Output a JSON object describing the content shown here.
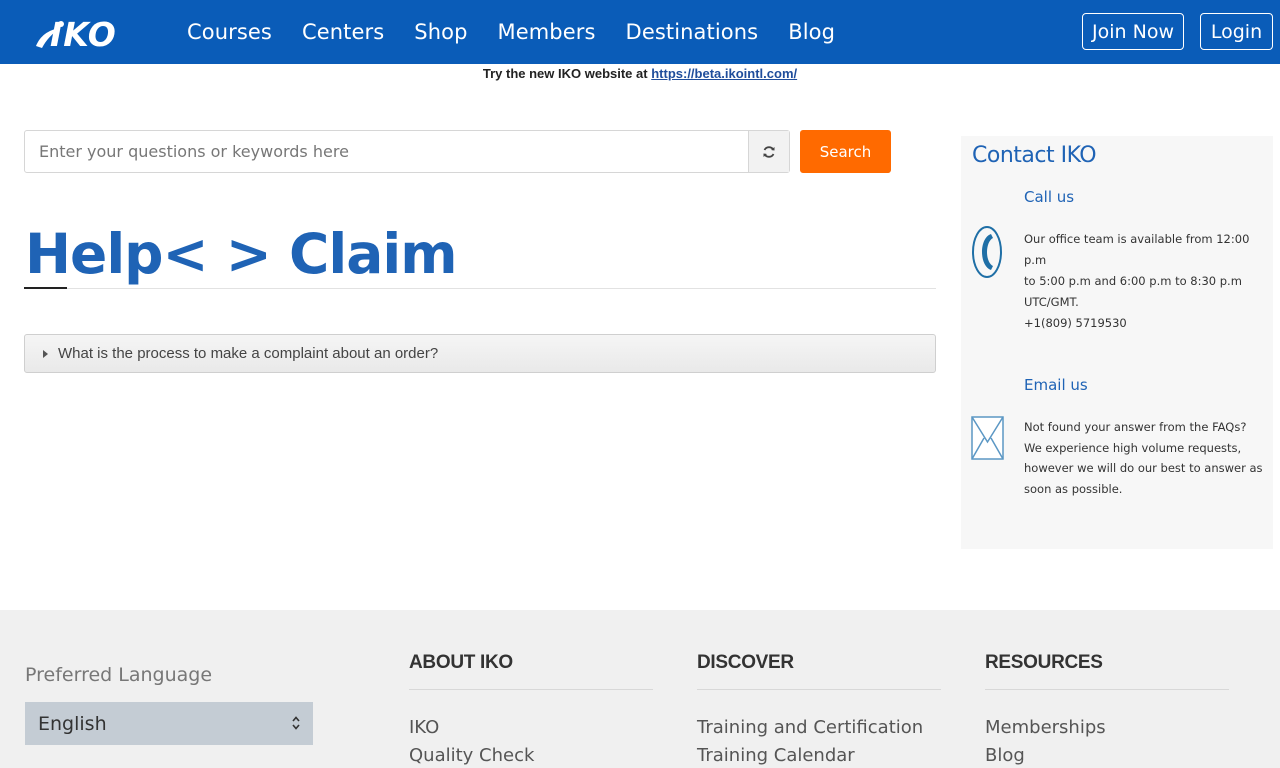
{
  "header": {
    "logo_text": "IKO",
    "nav": [
      "Courses",
      "Centers",
      "Shop",
      "Members",
      "Destinations",
      "Blog"
    ],
    "join_label": "Join Now",
    "login_label": "Login",
    "brand_color": "#0a5cb8"
  },
  "announcement": {
    "text": "Try the new IKO website at",
    "link": "https://beta.ikointl.com/"
  },
  "search": {
    "placeholder": "Enter your questions or keywords here",
    "refresh_icon": "refresh-icon",
    "button_label": "Search",
    "button_color": "#ff6a00"
  },
  "main": {
    "title": "Help< > Claim",
    "faq": [
      {
        "question": "What is the process to make a complaint about an order?"
      }
    ]
  },
  "contact": {
    "title": "Contact IKO",
    "call": {
      "heading": "Call us",
      "lines": [
        "Our office team is available from 12:00 p.m",
        "to 5:00 p.m and 6:00 p.m to 8:30 p.m",
        "UTC/GMT.",
        "+1(809) 5719530"
      ]
    },
    "email": {
      "heading": "Email us",
      "lines": [
        "Not found your answer from the FAQs?",
        "We experience high volume requests,",
        "however we will do our best to answer as",
        "soon as possible."
      ]
    }
  },
  "footer": {
    "language_label": "Preferred Language",
    "language_value": "English",
    "columns": [
      {
        "heading": "ABOUT IKO",
        "links": [
          "IKO",
          "Quality Check"
        ]
      },
      {
        "heading": "DISCOVER",
        "links": [
          "Training and Certification",
          "Training Calendar"
        ]
      },
      {
        "heading": "RESOURCES",
        "links": [
          "Memberships",
          "Blog"
        ]
      }
    ]
  }
}
